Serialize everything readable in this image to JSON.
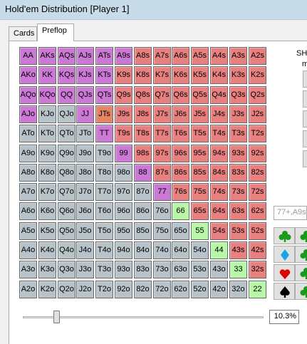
{
  "window": {
    "title": "Hold'em Distribution [Player 1]"
  },
  "tabs": [
    {
      "label": "Cards",
      "active": false
    },
    {
      "label": "Preflop",
      "active": true
    }
  ],
  "sidebar": {
    "sh_label": "SH",
    "sub_label": "m",
    "range_text": "77+,A9s"
  },
  "suits": [
    {
      "icon": "club-icon",
      "color": "#1a9a1a"
    },
    {
      "icon": "diamond-icon",
      "color": "#1aa3e8"
    },
    {
      "icon": "heart-icon",
      "color": "#e00000"
    },
    {
      "icon": "spade-icon",
      "color": "#000000"
    }
  ],
  "colors": {
    "selected": "#cc79d6",
    "suited": "#e88080",
    "offsuit": "#b8c2c9",
    "pair": "#b9f7a8",
    "highlight": "#e58365"
  },
  "grid": {
    "rows": [
      [
        [
          "AA",
          "sel"
        ],
        [
          "AKs",
          "sel"
        ],
        [
          "AQs",
          "sel"
        ],
        [
          "AJs",
          "sel"
        ],
        [
          "ATs",
          "sel"
        ],
        [
          "A9s",
          "sel"
        ],
        [
          "A8s",
          "red"
        ],
        [
          "A7s",
          "red"
        ],
        [
          "A6s",
          "red"
        ],
        [
          "A5s",
          "red"
        ],
        [
          "A4s",
          "red"
        ],
        [
          "A3s",
          "red"
        ],
        [
          "A2s",
          "red"
        ]
      ],
      [
        [
          "AKo",
          "sel"
        ],
        [
          "KK",
          "sel"
        ],
        [
          "KQs",
          "sel"
        ],
        [
          "KJs",
          "sel"
        ],
        [
          "KTs",
          "sel"
        ],
        [
          "K9s",
          "red"
        ],
        [
          "K8s",
          "red"
        ],
        [
          "K7s",
          "red"
        ],
        [
          "K6s",
          "red"
        ],
        [
          "K5s",
          "red"
        ],
        [
          "K4s",
          "red"
        ],
        [
          "K3s",
          "red"
        ],
        [
          "K2s",
          "red"
        ]
      ],
      [
        [
          "AQo",
          "sel"
        ],
        [
          "KQo",
          "sel"
        ],
        [
          "QQ",
          "sel"
        ],
        [
          "QJs",
          "sel"
        ],
        [
          "QTs",
          "sel"
        ],
        [
          "Q9s",
          "red"
        ],
        [
          "Q8s",
          "red"
        ],
        [
          "Q7s",
          "red"
        ],
        [
          "Q6s",
          "red"
        ],
        [
          "Q5s",
          "red"
        ],
        [
          "Q4s",
          "red"
        ],
        [
          "Q3s",
          "red"
        ],
        [
          "Q2s",
          "red"
        ]
      ],
      [
        [
          "AJo",
          "sel"
        ],
        [
          "KJo",
          "gray"
        ],
        [
          "QJo",
          "gray"
        ],
        [
          "JJ",
          "sel"
        ],
        [
          "JTs",
          "orange"
        ],
        [
          "J9s",
          "red"
        ],
        [
          "J8s",
          "red"
        ],
        [
          "J7s",
          "red"
        ],
        [
          "J6s",
          "red"
        ],
        [
          "J5s",
          "red"
        ],
        [
          "J4s",
          "red"
        ],
        [
          "J3s",
          "red"
        ],
        [
          "J2s",
          "red"
        ]
      ],
      [
        [
          "ATo",
          "gray"
        ],
        [
          "KTo",
          "gray"
        ],
        [
          "QTo",
          "gray"
        ],
        [
          "JTo",
          "gray"
        ],
        [
          "TT",
          "sel"
        ],
        [
          "T9s",
          "red"
        ],
        [
          "T8s",
          "red"
        ],
        [
          "T7s",
          "red"
        ],
        [
          "T6s",
          "red"
        ],
        [
          "T5s",
          "red"
        ],
        [
          "T4s",
          "red"
        ],
        [
          "T3s",
          "red"
        ],
        [
          "T2s",
          "red"
        ]
      ],
      [
        [
          "A9o",
          "gray"
        ],
        [
          "K9o",
          "gray"
        ],
        [
          "Q9o",
          "gray"
        ],
        [
          "J9o",
          "gray"
        ],
        [
          "T9o",
          "gray"
        ],
        [
          "99",
          "sel"
        ],
        [
          "98s",
          "red"
        ],
        [
          "97s",
          "red"
        ],
        [
          "96s",
          "red"
        ],
        [
          "95s",
          "red"
        ],
        [
          "94s",
          "red"
        ],
        [
          "93s",
          "red"
        ],
        [
          "92s",
          "red"
        ]
      ],
      [
        [
          "A8o",
          "gray"
        ],
        [
          "K8o",
          "gray"
        ],
        [
          "Q8o",
          "gray"
        ],
        [
          "J8o",
          "gray"
        ],
        [
          "T8o",
          "gray"
        ],
        [
          "98o",
          "gray"
        ],
        [
          "88",
          "sel"
        ],
        [
          "87s",
          "red"
        ],
        [
          "86s",
          "red"
        ],
        [
          "85s",
          "red"
        ],
        [
          "84s",
          "red"
        ],
        [
          "83s",
          "red"
        ],
        [
          "82s",
          "red"
        ]
      ],
      [
        [
          "A7o",
          "gray"
        ],
        [
          "K7o",
          "gray"
        ],
        [
          "Q7o",
          "gray"
        ],
        [
          "J7o",
          "gray"
        ],
        [
          "T7o",
          "gray"
        ],
        [
          "97o",
          "gray"
        ],
        [
          "87o",
          "gray"
        ],
        [
          "77",
          "sel"
        ],
        [
          "76s",
          "red"
        ],
        [
          "75s",
          "red"
        ],
        [
          "74s",
          "red"
        ],
        [
          "73s",
          "red"
        ],
        [
          "72s",
          "red"
        ]
      ],
      [
        [
          "A6o",
          "gray"
        ],
        [
          "K6o",
          "gray"
        ],
        [
          "Q6o",
          "gray"
        ],
        [
          "J6o",
          "gray"
        ],
        [
          "T6o",
          "gray"
        ],
        [
          "96o",
          "gray"
        ],
        [
          "86o",
          "gray"
        ],
        [
          "76o",
          "gray"
        ],
        [
          "66",
          "green"
        ],
        [
          "65s",
          "red"
        ],
        [
          "64s",
          "red"
        ],
        [
          "63s",
          "red"
        ],
        [
          "62s",
          "red"
        ]
      ],
      [
        [
          "A5o",
          "gray"
        ],
        [
          "K5o",
          "gray"
        ],
        [
          "Q5o",
          "gray"
        ],
        [
          "J5o",
          "gray"
        ],
        [
          "T5o",
          "gray"
        ],
        [
          "95o",
          "gray"
        ],
        [
          "85o",
          "gray"
        ],
        [
          "75o",
          "gray"
        ],
        [
          "65o",
          "gray"
        ],
        [
          "55",
          "green"
        ],
        [
          "54s",
          "red"
        ],
        [
          "53s",
          "red"
        ],
        [
          "52s",
          "red"
        ]
      ],
      [
        [
          "A4o",
          "gray"
        ],
        [
          "K4o",
          "gray"
        ],
        [
          "Q4o",
          "gray"
        ],
        [
          "J4o",
          "gray"
        ],
        [
          "T4o",
          "gray"
        ],
        [
          "94o",
          "gray"
        ],
        [
          "84o",
          "gray"
        ],
        [
          "74o",
          "gray"
        ],
        [
          "64o",
          "gray"
        ],
        [
          "54o",
          "gray"
        ],
        [
          "44",
          "green"
        ],
        [
          "43s",
          "red"
        ],
        [
          "42s",
          "red"
        ]
      ],
      [
        [
          "A3o",
          "gray"
        ],
        [
          "K3o",
          "gray"
        ],
        [
          "Q3o",
          "gray"
        ],
        [
          "J3o",
          "gray"
        ],
        [
          "T3o",
          "gray"
        ],
        [
          "93o",
          "gray"
        ],
        [
          "83o",
          "gray"
        ],
        [
          "73o",
          "gray"
        ],
        [
          "63o",
          "gray"
        ],
        [
          "53o",
          "gray"
        ],
        [
          "43o",
          "gray"
        ],
        [
          "33",
          "green"
        ],
        [
          "32s",
          "red"
        ]
      ],
      [
        [
          "A2o",
          "gray"
        ],
        [
          "K2o",
          "gray"
        ],
        [
          "Q2o",
          "gray"
        ],
        [
          "J2o",
          "gray"
        ],
        [
          "T2o",
          "gray"
        ],
        [
          "92o",
          "gray"
        ],
        [
          "82o",
          "gray"
        ],
        [
          "72o",
          "gray"
        ],
        [
          "62o",
          "gray"
        ],
        [
          "52o",
          "gray"
        ],
        [
          "42o",
          "gray"
        ],
        [
          "32o",
          "gray"
        ],
        [
          "22",
          "green"
        ]
      ]
    ]
  },
  "slider": {
    "value_fraction": 0.13
  },
  "percent": {
    "text": "10.3%"
  }
}
